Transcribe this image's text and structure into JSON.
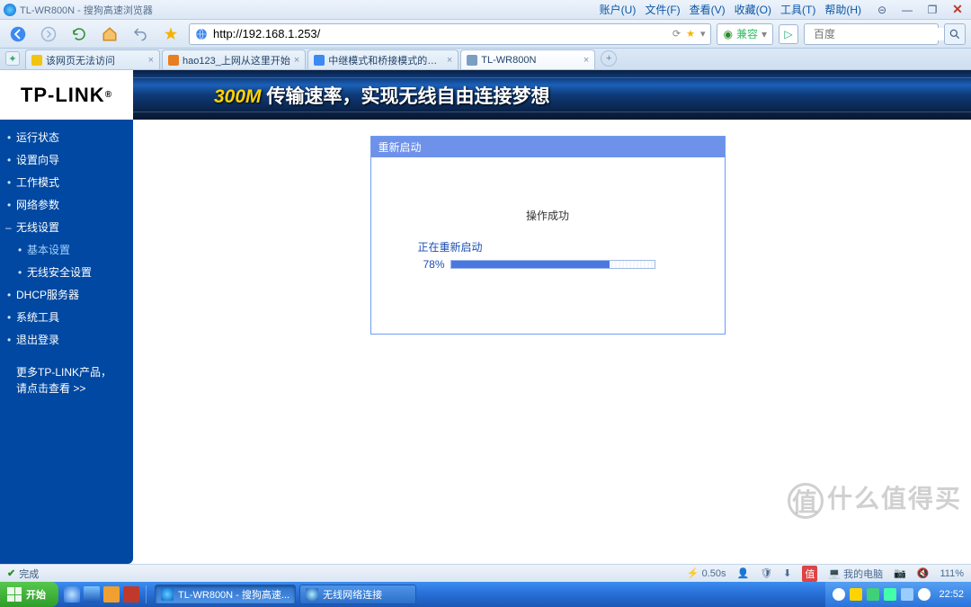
{
  "window": {
    "title": "TL-WR800N - 搜狗高速浏览器",
    "menus": [
      "账户(U)",
      "文件(F)",
      "查看(V)",
      "收藏(O)",
      "工具(T)",
      "帮助(H)"
    ]
  },
  "nav": {
    "url": "http://192.168.1.253/",
    "compat_label": "兼容",
    "search_placeholder": "百度"
  },
  "tabs": [
    {
      "label": "该网页无法访问",
      "icon": "warn",
      "active": false
    },
    {
      "label": "hao123_上网从这里开始",
      "icon": "hao",
      "active": false
    },
    {
      "label": "中继模式和桥接模式的区...",
      "icon": "doc",
      "active": false
    },
    {
      "label": "TL-WR800N",
      "icon": "tp",
      "active": true
    }
  ],
  "banner": {
    "logo": "TP-LINK",
    "m300": "300M",
    "slogan": "传输速率，实现无线自由连接梦想"
  },
  "sidebar": {
    "items": [
      {
        "label": "运行状态",
        "type": "item"
      },
      {
        "label": "设置向导",
        "type": "item"
      },
      {
        "label": "工作模式",
        "type": "item"
      },
      {
        "label": "网络参数",
        "type": "item"
      },
      {
        "label": "无线设置",
        "type": "exp"
      },
      {
        "label": "基本设置",
        "type": "sub",
        "active": true
      },
      {
        "label": "无线安全设置",
        "type": "sub"
      },
      {
        "label": "DHCP服务器",
        "type": "item"
      },
      {
        "label": "系统工具",
        "type": "item"
      },
      {
        "label": "退出登录",
        "type": "item"
      }
    ],
    "more_line1": "更多TP-LINK产品，",
    "more_line2": "请点击查看 >>"
  },
  "panel": {
    "title": "重新启动",
    "success": "操作成功",
    "rebooting": "正在重新启动",
    "percent": "78%",
    "percent_value": 78
  },
  "browser_status": {
    "done": "完成",
    "speed": "0.50s",
    "zhi": "值",
    "mycomp": "我的电脑",
    "zoom": "111%"
  },
  "taskbar": {
    "start": "开始",
    "tasks": [
      {
        "label": "TL-WR800N - 搜狗高速...",
        "icon": "sogou",
        "active": true
      },
      {
        "label": "无线网络连接",
        "icon": "wifi",
        "active": false
      }
    ],
    "clock": "22:52"
  },
  "watermark": "什么值得买"
}
